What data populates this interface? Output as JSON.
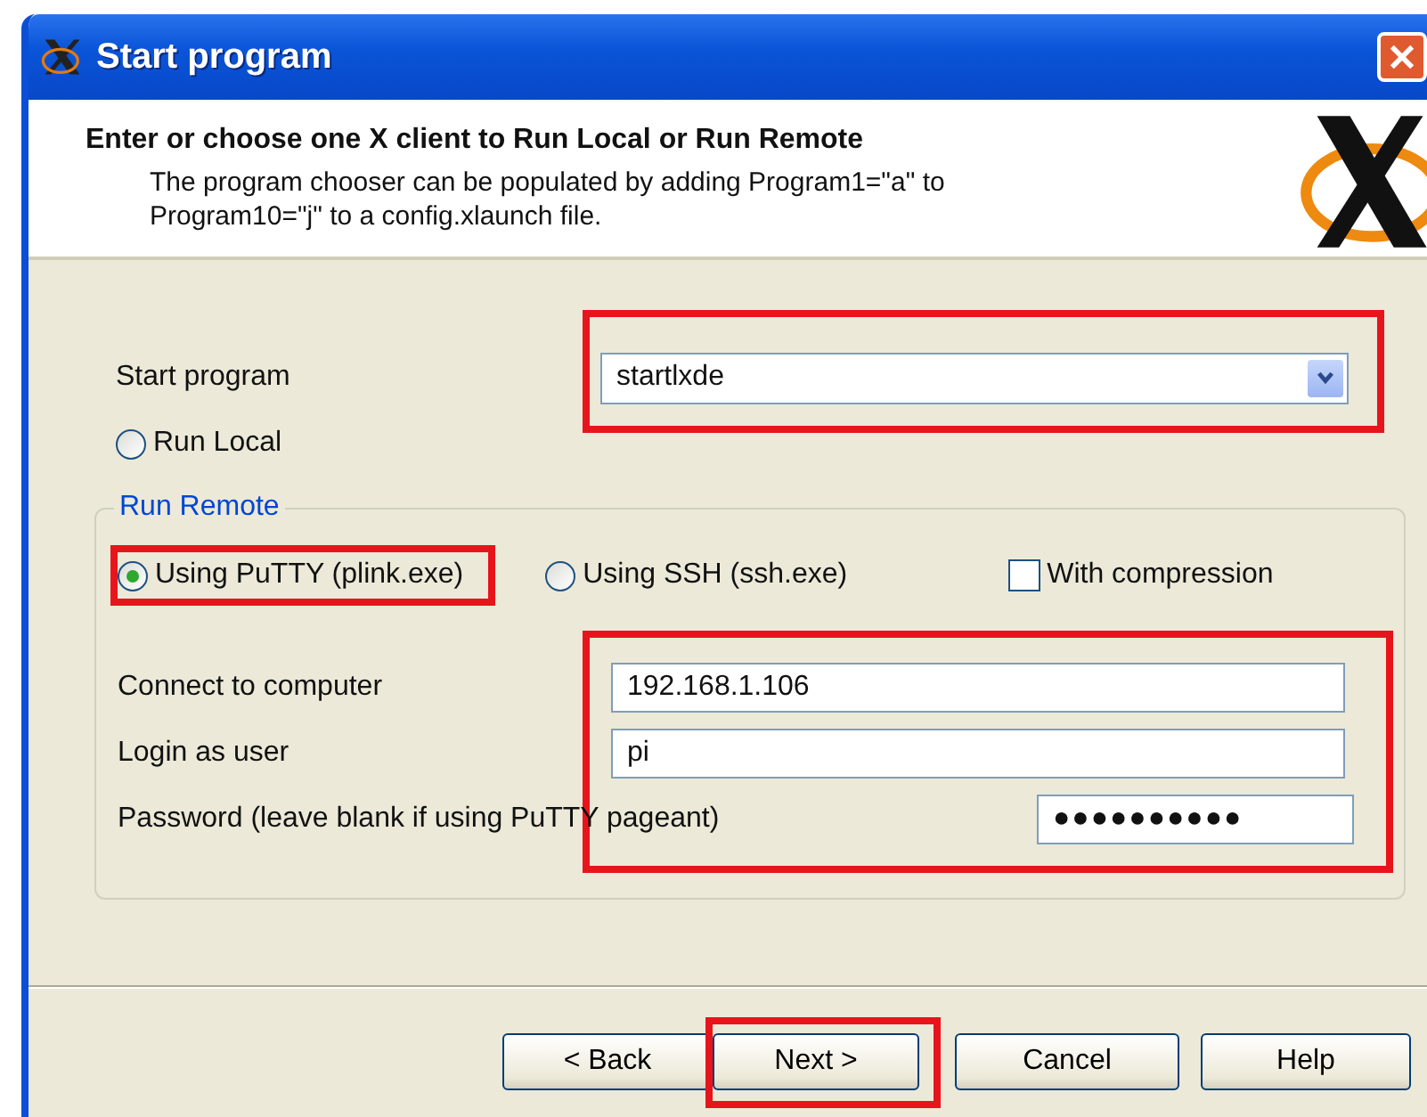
{
  "window": {
    "title": "Start program"
  },
  "header": {
    "heading": "Enter or choose one X client to Run Local or Run Remote",
    "description_lines": [
      "The program chooser can be populated by adding Program1=\"a\" to",
      "Program10=\"j\" to a config.xlaunch file."
    ]
  },
  "start_program": {
    "label": "Start program",
    "value": "startlxde",
    "highlighted": true
  },
  "run_local": {
    "label": "Run Local",
    "selected": false
  },
  "run_remote": {
    "legend": "Run Remote",
    "options": [
      {
        "kind": "radio",
        "label": "Using PuTTY (plink.exe)",
        "selected": true,
        "highlighted": true
      },
      {
        "kind": "radio",
        "label": "Using SSH (ssh.exe)",
        "selected": false,
        "highlighted": false
      },
      {
        "kind": "checkbox",
        "label": "With compression",
        "checked": false,
        "highlighted": false
      }
    ],
    "fields_highlighted": true,
    "fields": [
      {
        "kind": "wide",
        "label": "Connect to computer",
        "value": "192.168.1.106"
      },
      {
        "kind": "wide",
        "label": "Login as user",
        "value": "pi"
      },
      {
        "kind": "short",
        "label": "Password (leave blank if using PuTTY pageant)",
        "value": "●●●●●●●●●●"
      }
    ]
  },
  "buttons": [
    {
      "label": "< Back",
      "highlighted": false
    },
    {
      "label": "Next >",
      "highlighted": true
    },
    {
      "label": "Cancel",
      "highlighted": false
    },
    {
      "label": "Help",
      "highlighted": false
    }
  ]
}
